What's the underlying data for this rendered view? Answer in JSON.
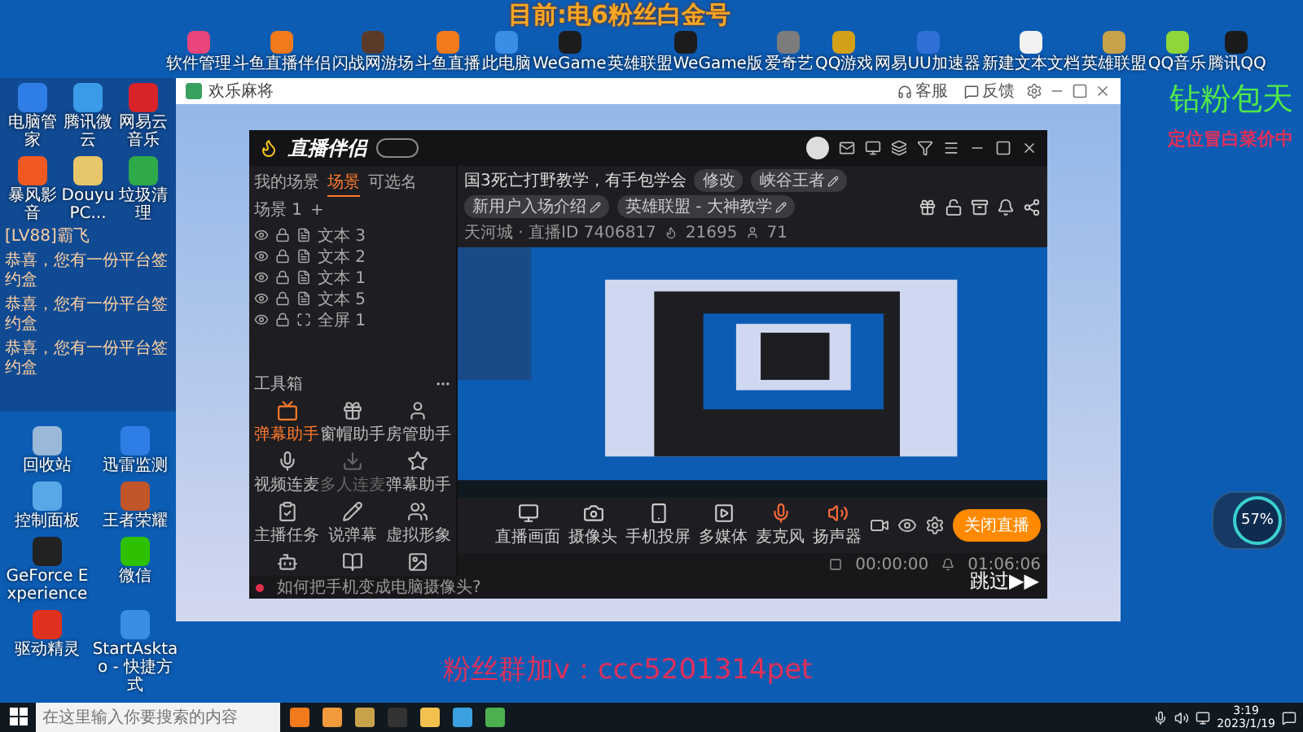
{
  "desktop": {
    "top_icons": [
      {
        "label": "软件管理",
        "color": "#e9457a"
      },
      {
        "label": "斗鱼直播伴侣",
        "color": "#f07a1c"
      },
      {
        "label": "闪战网游场",
        "color": "#5a3b2a"
      },
      {
        "label": "斗鱼直播",
        "color": "#f07a1c"
      },
      {
        "label": "此电脑",
        "color": "#3a8ee6"
      },
      {
        "label": "WeGame",
        "color": "#1c1c1c"
      },
      {
        "label": "英雄联盟WeGame版",
        "color": "#1c1c1c"
      },
      {
        "label": "爱奇艺",
        "color": "#7c7c7c"
      },
      {
        "label": "QQ游戏",
        "color": "#d4a017"
      },
      {
        "label": "网易UU加速器",
        "color": "#2f6fd6"
      },
      {
        "label": "新建文本文档",
        "color": "#f2f2f2"
      },
      {
        "label": "英雄联盟",
        "color": "#c8a24a"
      },
      {
        "label": "QQ音乐",
        "color": "#8fd63a"
      },
      {
        "label": "腾讯QQ",
        "color": "#1b1b1b"
      }
    ],
    "overlay_title": "目前:电6粉丝白金号",
    "chat_icons": [
      {
        "label": "电脑管家",
        "color": "#2f7ee6"
      },
      {
        "label": "腾讯微云",
        "color": "#3a9be8"
      },
      {
        "label": "网易云音乐",
        "color": "#d8232a"
      },
      {
        "label": "暴风影音",
        "color": "#f05a22"
      },
      {
        "label": "DouyuPC...",
        "color": "#e8c66a"
      },
      {
        "label": "垃圾清理",
        "color": "#2faa4a"
      }
    ],
    "chat_lines": [
      "[LV88]霸飞",
      "恭喜，您有一份平台签约盒",
      "恭喜，您有一份平台签约盒",
      "恭喜，您有一份平台签约盒"
    ],
    "left_icons": [
      {
        "label": "回收站",
        "color": "#9ab8d8"
      },
      {
        "label": "迅雷监测",
        "color": "#2f7ee6"
      },
      {
        "label": "控制面板",
        "color": "#58a8e8"
      },
      {
        "label": "王者荣耀",
        "color": "#c0562a"
      },
      {
        "label": "GeForce Experience",
        "color": "#222222"
      },
      {
        "label": "微信",
        "color": "#2dc100"
      },
      {
        "label": "驱动精灵",
        "color": "#e0301e"
      },
      {
        "label": "StartAsktao - 快捷方式",
        "color": "#3a8ee6"
      }
    ],
    "side_banner": {
      "title": "钻粉包天",
      "subtitle": "定位冒白菜价中"
    },
    "fan_group": "粉丝群加v：ccc5201314pet",
    "net_meter": {
      "percent": "57%"
    }
  },
  "game_window": {
    "title": "欢乐麻将",
    "actions": [
      "客服",
      "反馈"
    ],
    "skip": "跳过▶▶"
  },
  "stream_app": {
    "name": "直播伴侣",
    "scene_tabs": [
      {
        "label": "我的场景",
        "selected": false
      },
      {
        "label": "场景",
        "selected": true
      },
      {
        "label": "可选名",
        "selected": false
      },
      {
        "label": "场景 1",
        "selected": false
      }
    ],
    "add_tab": "+",
    "layers": [
      {
        "kind": "text",
        "label": "文本 3"
      },
      {
        "kind": "text",
        "label": "文本 2"
      },
      {
        "kind": "text",
        "label": "文本 1"
      },
      {
        "kind": "text",
        "label": "文本 5"
      },
      {
        "kind": "screen",
        "label": "全屏 1"
      }
    ],
    "toolbox_title": "工具箱",
    "tools": [
      {
        "label": "弹幕助手",
        "selected": true,
        "disabled": false
      },
      {
        "label": "窗帽助手",
        "selected": false,
        "disabled": false
      },
      {
        "label": "房管助手",
        "selected": false,
        "disabled": false
      },
      {
        "label": "视频连麦",
        "selected": false,
        "disabled": false
      },
      {
        "label": "多人连麦",
        "selected": false,
        "disabled": true
      },
      {
        "label": "弹幕助手",
        "selected": false,
        "disabled": false
      },
      {
        "label": "主播任务",
        "selected": false,
        "disabled": false
      },
      {
        "label": "说弹幕",
        "selected": false,
        "disabled": false
      },
      {
        "label": "虚拟形象",
        "selected": false,
        "disabled": false
      },
      {
        "selected": false,
        "disabled": false
      },
      {
        "selected": false,
        "disabled": false
      },
      {
        "selected": false,
        "disabled": false
      }
    ],
    "stream_title": "国3死亡打野教学，有手包学会",
    "edit_label": "修改",
    "tags": [
      "峡谷王者",
      "新用户入场介绍"
    ],
    "category": "英雄联盟 - 大神教学",
    "room": "天河城 · 直播ID 7406817",
    "popularity": "21695",
    "viewers": "71",
    "controls": [
      "直播画面",
      "摄像头",
      "手机投屏",
      "多媒体",
      "麦克风",
      "扬声器"
    ],
    "stop_button": "关闭直播",
    "tip": "如何把手机变成电脑摄像头?",
    "record_time": "00:00:00",
    "live_time": "01:06:06"
  },
  "taskbar": {
    "search_placeholder": "在这里输入你要搜索的内容",
    "apps": [
      {
        "color": "#f07a1c"
      },
      {
        "color": "#f09a3c"
      },
      {
        "color": "#c8a24a"
      },
      {
        "color": "#333333"
      },
      {
        "color": "#f2c14e"
      },
      {
        "color": "#3aa0e0"
      },
      {
        "color": "#4caf50"
      }
    ],
    "time": "3:19",
    "date": "2023/1/19"
  }
}
